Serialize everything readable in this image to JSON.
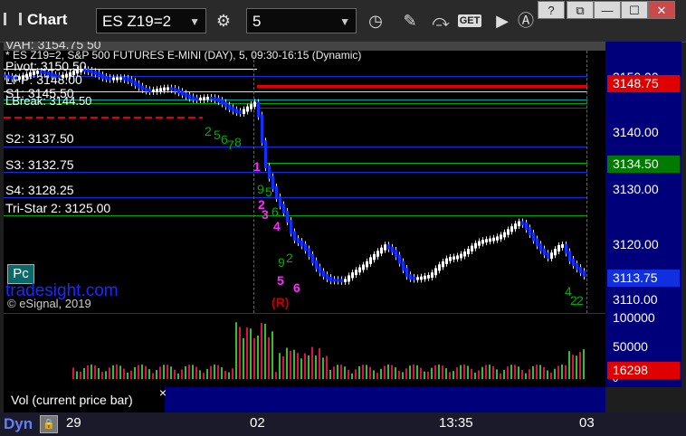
{
  "toolbar": {
    "title": "Chart",
    "symbol": "ES Z19=2",
    "interval": "5",
    "get_label": "GET",
    "window_buttons": [
      "?",
      "⧉",
      "—",
      "☐",
      "✕"
    ]
  },
  "chart": {
    "info_line": "* ES Z19=2, S&P 500 FUTURES E-MINI (DAY), 5, 09:30-16:15 (Dynamic)",
    "cut_label": "VAH: 3154.75 50",
    "levels": [
      {
        "label": "Pivot: 3150.50"
      },
      {
        "label": "LPP: 3148.00"
      },
      {
        "label": "S1: 3145.50"
      },
      {
        "label": "LBreak: 3144.50"
      },
      {
        "label": "S2: 3137.50"
      },
      {
        "label": "S3: 3132.75"
      },
      {
        "label": "S4: 3128.25"
      },
      {
        "label": "Tri-Star 2: 3125.00"
      }
    ],
    "price_ticks": [
      "3150.00",
      "3140.00",
      "3130.00",
      "3120.00",
      "3110.00"
    ],
    "price_tags": [
      {
        "value": "3148.75",
        "color": "#e00000"
      },
      {
        "value": "3134.50",
        "color": "#007a00"
      },
      {
        "value": "3113.75",
        "color": "#1030e0"
      }
    ],
    "annotations": {
      "magenta": [
        "1",
        "2",
        "3",
        "4",
        "5",
        "6"
      ],
      "green": [
        "2",
        "5",
        "6",
        "7",
        "8",
        "9",
        "5",
        "6",
        "9",
        "2",
        "4",
        "2",
        "2"
      ],
      "reversal": "(R)"
    },
    "pc_label": "Pc",
    "watermark": "tradesight.com",
    "copyright": "© eSignal, 2019"
  },
  "volume": {
    "ticks": [
      "100000",
      "50000",
      "0"
    ],
    "tag": "16298",
    "legend": "Vol (current price bar)",
    "close_glyph": "×"
  },
  "timeaxis": {
    "dyn": "Dyn",
    "labels": [
      "29",
      "02",
      "13:35",
      "03"
    ]
  }
}
